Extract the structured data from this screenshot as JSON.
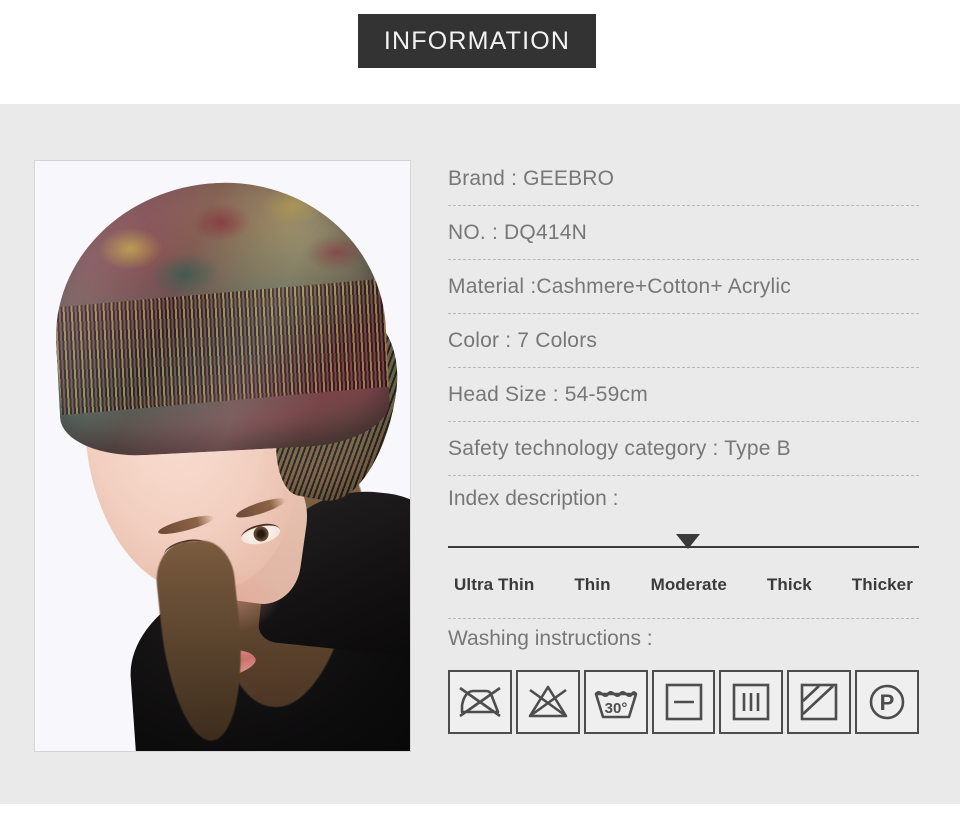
{
  "header": {
    "banner_title": "INFORMATION",
    "banner_bg": "#333333",
    "banner_text_color": "#f2f2f2"
  },
  "product_photo": {
    "alt": "Woman wearing multicolor floral jacquard slouchy beanie hat, side profile on white background"
  },
  "specs": [
    {
      "label": "Brand",
      "text": "Brand : GEEBRO"
    },
    {
      "label": "NO.",
      "text": "NO. : DQ414N"
    },
    {
      "label": "Material",
      "text": "Material :Cashmere+Cotton+ Acrylic"
    },
    {
      "label": "Color",
      "text": "Color : 7 Colors"
    },
    {
      "label": "Head Size",
      "text": "Head Size : 54-59cm"
    },
    {
      "label": "Safety technology category",
      "text": "Safety technology category : Type B"
    }
  ],
  "index": {
    "title": "Index description :",
    "levels": [
      "Ultra Thin",
      "Thin",
      "Moderate",
      "Thick",
      "Thicker"
    ],
    "selected": "Moderate",
    "selected_index": 2
  },
  "washing": {
    "title": "Washing instructions :",
    "icons": [
      {
        "name": "do-not-iron-icon",
        "label": "Do not iron"
      },
      {
        "name": "do-not-bleach-icon",
        "label": "Do not bleach"
      },
      {
        "name": "machine-wash-30-icon",
        "label": "Machine wash 30°",
        "temperature": "30°"
      },
      {
        "name": "dry-flat-icon",
        "label": "Dry flat"
      },
      {
        "name": "drip-dry-icon",
        "label": "Drip dry"
      },
      {
        "name": "dry-in-shade-icon",
        "label": "Dry in shade"
      },
      {
        "name": "professional-dry-clean-p-icon",
        "label": "Professional dry clean",
        "letter": "P"
      }
    ]
  },
  "theme": {
    "page_bg": "#ffffff",
    "body_bg": "#eaeaea",
    "text_gray": "#777777",
    "text_dark": "#3a3a3a",
    "divider": "#b9b9b9"
  }
}
